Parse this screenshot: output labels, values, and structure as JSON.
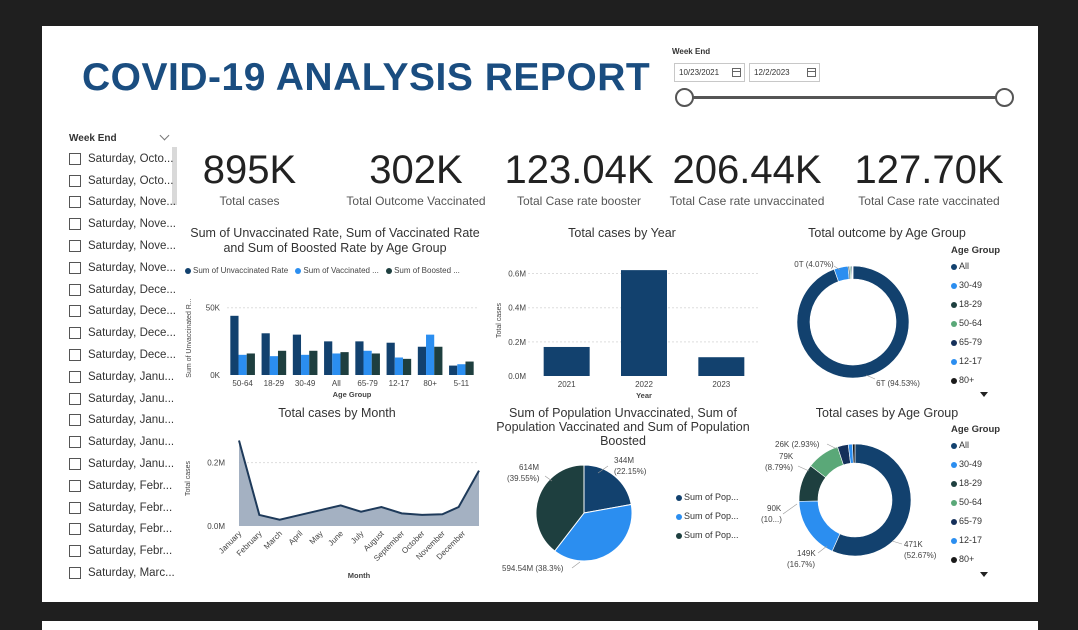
{
  "report": {
    "title": "COVID-19 ANALYSIS REPORT",
    "date_filter": {
      "label": "Week End",
      "start": "10/23/2021",
      "end": "12/2/2023"
    }
  },
  "week_filter": {
    "title": "Week End",
    "items": [
      "Saturday, Octo...",
      "Saturday, Octo...",
      "Saturday, Nove...",
      "Saturday, Nove...",
      "Saturday, Nove...",
      "Saturday, Nove...",
      "Saturday, Dece...",
      "Saturday, Dece...",
      "Saturday, Dece...",
      "Saturday, Dece...",
      "Saturday, Janu...",
      "Saturday, Janu...",
      "Saturday, Janu...",
      "Saturday, Janu...",
      "Saturday, Janu...",
      "Saturday, Febr...",
      "Saturday, Febr...",
      "Saturday, Febr...",
      "Saturday, Febr...",
      "Saturday, Marc..."
    ]
  },
  "kpis": [
    {
      "value": "895K",
      "label": "Total cases"
    },
    {
      "value": "302K",
      "label": "Total Outcome Vaccinated"
    },
    {
      "value": "123.04K",
      "label": "Total Case rate booster"
    },
    {
      "value": "206.44K",
      "label": "Total Case rate unvaccinated"
    },
    {
      "value": "127.70K",
      "label": "Total Case rate vaccinated"
    }
  ],
  "colors": {
    "dark_navy": "#12416e",
    "blue": "#2b8ef0",
    "dark_teal": "#1e3f3f",
    "green": "#5aa878",
    "title_blue": "#1a4d80",
    "area": "#9aa8bb"
  },
  "age_legend": {
    "header": "Age Group",
    "items": [
      {
        "label": "All",
        "color": "#12416e"
      },
      {
        "label": "30-49",
        "color": "#2b8ef0"
      },
      {
        "label": "18-29",
        "color": "#1e3f3f"
      },
      {
        "label": "50-64",
        "color": "#5aa878"
      },
      {
        "label": "65-79",
        "color": "#15305a"
      },
      {
        "label": "12-17",
        "color": "#2b8ef0"
      },
      {
        "label": "80+",
        "color": "#1a1a1a"
      }
    ]
  },
  "charts": {
    "rates": {
      "title": "Sum of Unvaccinated Rate, Sum of Vaccinated Rate and Sum of Boosted Rate by Age Group",
      "legend": [
        "Sum of Unvaccinated Rate",
        "Sum of Vaccinated ...",
        "Sum of Boosted ..."
      ],
      "ylabel": "Sum of Unvaccinated R...",
      "xlabel": "Age Group",
      "ytick_labels": [
        "0K",
        "50K"
      ]
    },
    "year": {
      "title": "Total cases by Year",
      "ylabel": "Total cases",
      "xlabel": "Year",
      "ytick_labels": [
        "0.0M",
        "0.2M",
        "0.4M",
        "0.6M"
      ]
    },
    "outcome_age": {
      "title": "Total outcome by Age Group",
      "labels": [
        "0T (4.07%)",
        "6T (94.53%)"
      ]
    },
    "month": {
      "title": "Total cases by Month",
      "ylabel": "Total cases",
      "xlabel": "Month",
      "ytick_labels": [
        "0.0M",
        "0.2M"
      ]
    },
    "population": {
      "title": "Sum of Population Unvaccinated, Sum of Population Vaccinated and Sum of Population Boosted",
      "legend": [
        "Sum of Pop...",
        "Sum of Pop...",
        "Sum of Pop..."
      ],
      "labels": [
        "344M",
        "(22.15%)",
        "614M",
        "(39.55%)",
        "594.54M (38.3%)"
      ]
    },
    "cases_age": {
      "title": "Total cases by Age Group",
      "labels": [
        "26K (2.93%)",
        "79K",
        "(8.79%)",
        "90K",
        "(10...)",
        "149K",
        "(16.7%)",
        "471K",
        "(52.67%)"
      ]
    }
  },
  "chart_data": [
    {
      "type": "bar",
      "title": "Sum of Unvaccinated Rate, Sum of Vaccinated Rate and Sum of Boosted Rate by Age Group",
      "categories": [
        "50-64",
        "18-29",
        "30-49",
        "All",
        "65-79",
        "12-17",
        "80+",
        "5-11"
      ],
      "series": [
        {
          "name": "Sum of Unvaccinated Rate",
          "values": [
            44,
            31,
            30,
            25,
            25,
            24,
            21,
            7
          ]
        },
        {
          "name": "Sum of Vaccinated ...",
          "values": [
            15,
            14,
            15,
            16,
            18,
            13,
            30,
            8
          ]
        },
        {
          "name": "Sum of Boosted ...",
          "values": [
            16,
            18,
            18,
            17,
            16,
            12,
            21,
            10
          ]
        }
      ],
      "ylim": [
        0,
        55
      ],
      "xlabel": "Age Group",
      "ylabel": "Sum of Unvaccinated R..."
    },
    {
      "type": "bar",
      "title": "Total cases by Year",
      "categories": [
        "2021",
        "2022",
        "2023"
      ],
      "values": [
        0.17,
        0.62,
        0.11
      ],
      "ylim": [
        0,
        0.65
      ],
      "xlabel": "Year",
      "ylabel": "Total cases"
    },
    {
      "type": "pie",
      "title": "Total outcome by Age Group",
      "categories": [
        "All",
        "30-49",
        "18-29",
        "50-64",
        "65-79",
        "12-17",
        "80+"
      ],
      "values": [
        94.53,
        4.07,
        0.4,
        0.35,
        0.3,
        0.2,
        0.15
      ],
      "labels": [
        "6T (94.53%)",
        "0T (4.07%)"
      ]
    },
    {
      "type": "area",
      "title": "Total cases by Month",
      "categories": [
        "January",
        "February",
        "March",
        "April",
        "May",
        "June",
        "July",
        "August",
        "September",
        "October",
        "November",
        "December"
      ],
      "values": [
        0.27,
        0.035,
        0.02,
        0.035,
        0.05,
        0.065,
        0.045,
        0.06,
        0.04,
        0.035,
        0.037,
        0.06,
        0.175
      ],
      "x": [
        0,
        1,
        2,
        3,
        4,
        5,
        6,
        7,
        8,
        9,
        10,
        10.8,
        11.8
      ],
      "ylim": [
        0,
        0.3
      ],
      "xlabel": "Month",
      "ylabel": "Total cases"
    },
    {
      "type": "pie",
      "title": "Sum of Population Unvaccinated, Sum of Population Vaccinated and Sum of Population Boosted",
      "values": [
        344,
        594.54,
        614
      ],
      "labels": [
        "344M (22.15%)",
        "594.54M (38.3%)",
        "614M (39.55%)"
      ]
    },
    {
      "type": "pie",
      "title": "Total cases by Age Group",
      "categories": [
        "All",
        "30-49",
        "18-29",
        "50-64",
        "65-79",
        "12-17",
        "80+"
      ],
      "values": [
        471,
        149,
        90,
        79,
        26,
        10,
        6
      ],
      "labels": [
        "471K (52.67%)",
        "149K (16.7%)",
        "90K (10...)",
        "79K (8.79%)",
        "26K (2.93%)"
      ]
    }
  ]
}
